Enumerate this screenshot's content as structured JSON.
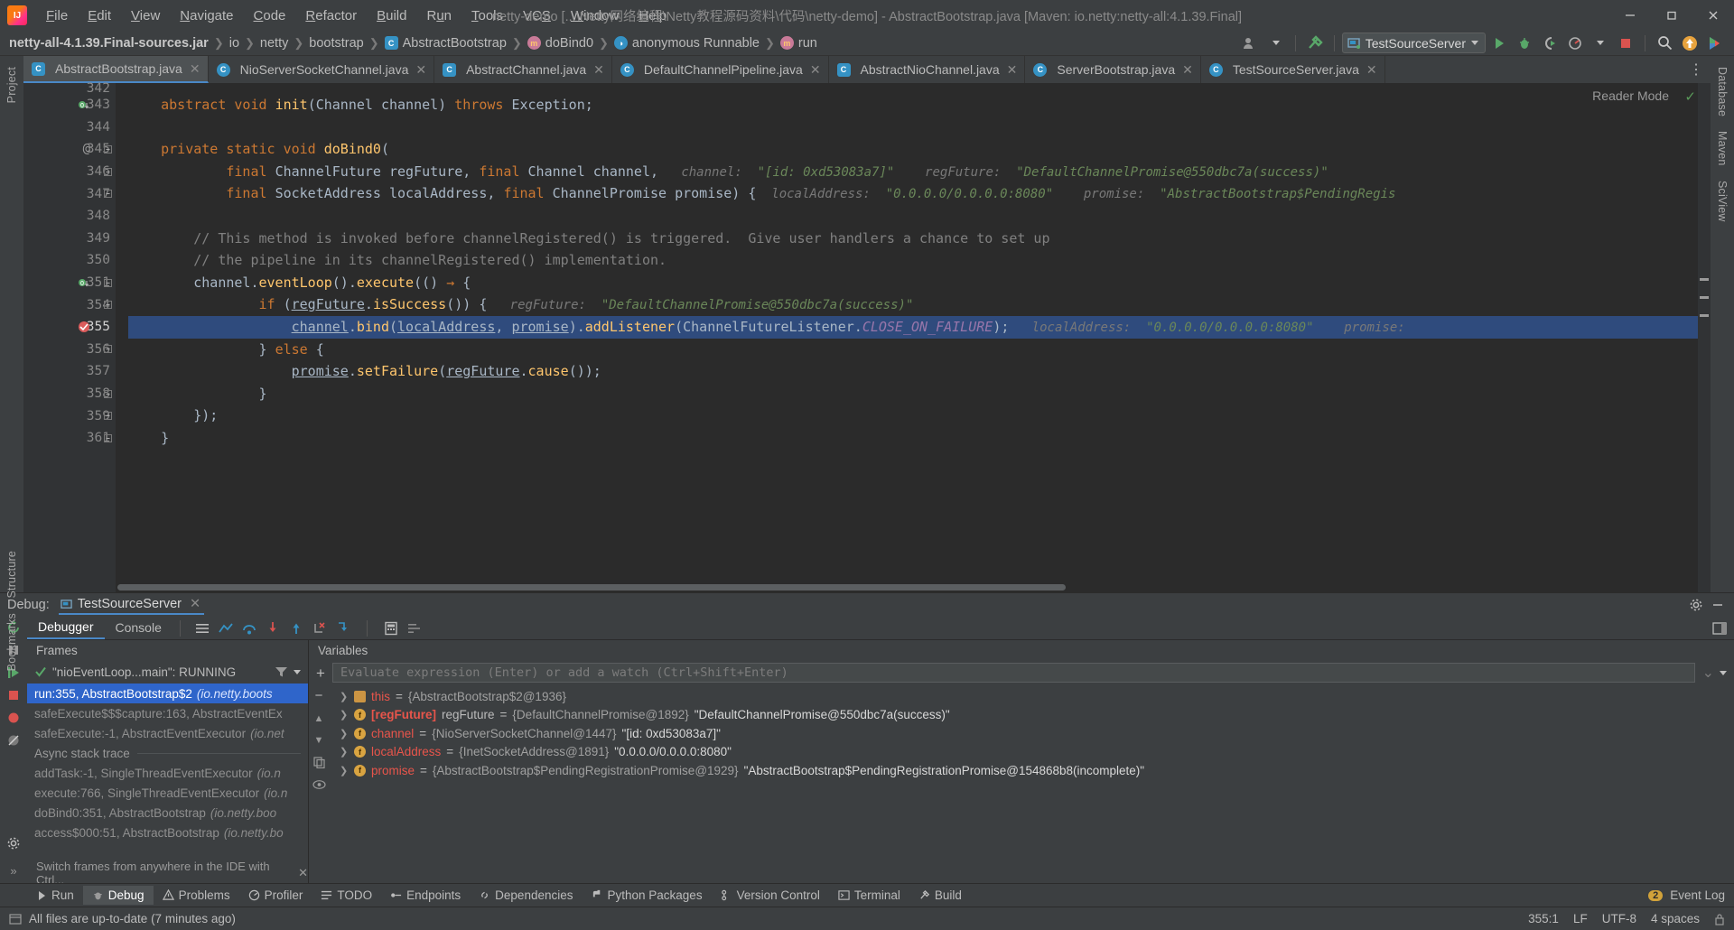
{
  "window": {
    "title": "netty-demo [...\\Netty网络编程\\Netty教程源码资料\\代码\\netty-demo] - AbstractBootstrap.java [Maven: io.netty:netty-all:4.1.39.Final]",
    "minimize": "—",
    "maximize": "▢",
    "close": "✕"
  },
  "menubar": [
    {
      "label": "File"
    },
    {
      "label": "Edit"
    },
    {
      "label": "View"
    },
    {
      "label": "Navigate"
    },
    {
      "label": "Code"
    },
    {
      "label": "Refactor"
    },
    {
      "label": "Build"
    },
    {
      "label": "Run"
    },
    {
      "label": "Tools"
    },
    {
      "label": "VCS"
    },
    {
      "label": "Window"
    },
    {
      "label": "Help"
    }
  ],
  "breadcrumbs": [
    {
      "label": "netty-all-4.1.39.Final-sources.jar",
      "icon": "jar-icon"
    },
    {
      "label": "io",
      "icon": "package-icon"
    },
    {
      "label": "netty",
      "icon": "package-icon"
    },
    {
      "label": "bootstrap",
      "icon": "package-icon"
    },
    {
      "label": "AbstractBootstrap",
      "icon": "class-icon"
    },
    {
      "label": "doBind0",
      "icon": "method-icon"
    },
    {
      "label": "anonymous Runnable",
      "icon": "anonymous-class-icon"
    },
    {
      "label": "run",
      "icon": "method-icon"
    }
  ],
  "toolbar": {
    "run_config": "TestSourceServer",
    "run_label": "Run",
    "debug_label": "Debug",
    "run_coverage_label": "Run with Coverage",
    "profile_label": "Profile",
    "stop_label": "Stop",
    "search_label": "Search Everywhere",
    "update_label": "Update Project",
    "share_label": "Share"
  },
  "editor_tabs": [
    {
      "label": "AbstractBootstrap.java",
      "active": true
    },
    {
      "label": "NioServerSocketChannel.java",
      "active": false
    },
    {
      "label": "AbstractChannel.java",
      "active": false
    },
    {
      "label": "DefaultChannelPipeline.java",
      "active": false
    },
    {
      "label": "AbstractNioChannel.java",
      "active": false
    },
    {
      "label": "ServerBootstrap.java",
      "active": false
    },
    {
      "label": "TestSourceServer.java",
      "active": false
    }
  ],
  "editor": {
    "reader_mode": "Reader Mode",
    "lines": [
      {
        "num": "342",
        "partial": true,
        "tokens": []
      },
      {
        "num": "343",
        "gutter_icon": "implemented-method-icon",
        "tokens": [
          {
            "t": "indent",
            "v": "    "
          },
          {
            "t": "kw",
            "v": "abstract void "
          },
          {
            "t": "mth",
            "v": "init"
          },
          {
            "t": "id",
            "v": "(Channel channel) "
          },
          {
            "t": "kw",
            "v": "throws "
          },
          {
            "t": "id",
            "v": "Exception;"
          }
        ]
      },
      {
        "num": "344",
        "tokens": []
      },
      {
        "num": "345",
        "gutter_icon": "annotation-icon",
        "fold": true,
        "tokens": [
          {
            "t": "indent",
            "v": "    "
          },
          {
            "t": "kw",
            "v": "private static void "
          },
          {
            "t": "mth",
            "v": "doBind0"
          },
          {
            "t": "id",
            "v": "("
          }
        ]
      },
      {
        "num": "346",
        "fold": true,
        "tokens": [
          {
            "t": "indent",
            "v": "            "
          },
          {
            "t": "kw",
            "v": "final "
          },
          {
            "t": "id",
            "v": "ChannelFuture regFuture, "
          },
          {
            "t": "kw",
            "v": "final "
          },
          {
            "t": "id",
            "v": "Channel channel,"
          },
          {
            "t": "hint",
            "v": "   channel:  "
          },
          {
            "t": "hintv",
            "v": "\"[id: 0xd53083a7]\""
          },
          {
            "t": "hint",
            "v": "    regFuture:  "
          },
          {
            "t": "hintv",
            "v": "\"DefaultChannelPromise@550dbc7a(success)\""
          }
        ]
      },
      {
        "num": "347",
        "fold": true,
        "tokens": [
          {
            "t": "indent",
            "v": "            "
          },
          {
            "t": "kw",
            "v": "final "
          },
          {
            "t": "id",
            "v": "SocketAddress localAddress, "
          },
          {
            "t": "kw",
            "v": "final "
          },
          {
            "t": "id",
            "v": "ChannelPromise promise) {"
          },
          {
            "t": "hint",
            "v": "  localAddress:  "
          },
          {
            "t": "hintv",
            "v": "\"0.0.0.0/0.0.0.0:8080\""
          },
          {
            "t": "hint",
            "v": "    promise:  "
          },
          {
            "t": "hintv",
            "v": "\"AbstractBootstrap$PendingRegis"
          }
        ]
      },
      {
        "num": "348",
        "tokens": []
      },
      {
        "num": "349",
        "tokens": [
          {
            "t": "indent",
            "v": "        "
          },
          {
            "t": "cmt",
            "v": "// This method is invoked before channelRegistered() is triggered.  Give user handlers a chance to set up"
          }
        ]
      },
      {
        "num": "350",
        "tokens": [
          {
            "t": "indent",
            "v": "        "
          },
          {
            "t": "cmt",
            "v": "// the pipeline in its channelRegistered() implementation."
          }
        ]
      },
      {
        "num": "351",
        "gutter_icon": "lambda-icon",
        "fold": true,
        "tokens": [
          {
            "t": "indent",
            "v": "        "
          },
          {
            "t": "id",
            "v": "channel."
          },
          {
            "t": "mth",
            "v": "eventLoop"
          },
          {
            "t": "id",
            "v": "()."
          },
          {
            "t": "mth",
            "v": "execute"
          },
          {
            "t": "id",
            "v": "(() "
          },
          {
            "t": "kw",
            "v": "→ "
          },
          {
            "t": "id",
            "v": "{"
          }
        ]
      },
      {
        "num": "354",
        "fold": true,
        "tokens": [
          {
            "t": "indent",
            "v": "                "
          },
          {
            "t": "kw",
            "v": "if "
          },
          {
            "t": "id",
            "v": "("
          },
          {
            "t": "ul",
            "v": "regFuture"
          },
          {
            "t": "id",
            "v": "."
          },
          {
            "t": "mth",
            "v": "isSuccess"
          },
          {
            "t": "id",
            "v": "()) {"
          },
          {
            "t": "hint",
            "v": "   regFuture:  "
          },
          {
            "t": "hintv",
            "v": "\"DefaultChannelPromise@550dbc7a(success)\""
          }
        ]
      },
      {
        "num": "355",
        "highlight": true,
        "gutter_icon": "breakpoint-hit-icon",
        "tokens": [
          {
            "t": "indent",
            "v": "                    "
          },
          {
            "t": "ul",
            "v": "channel"
          },
          {
            "t": "id",
            "v": "."
          },
          {
            "t": "mth",
            "v": "bind"
          },
          {
            "t": "id",
            "v": "("
          },
          {
            "t": "ul",
            "v": "localAddress"
          },
          {
            "t": "id",
            "v": ", "
          },
          {
            "t": "ul",
            "v": "promise"
          },
          {
            "t": "id",
            "v": ")."
          },
          {
            "t": "mth",
            "v": "addListener"
          },
          {
            "t": "id",
            "v": "(ChannelFutureListener."
          },
          {
            "t": "stat",
            "v": "CLOSE_ON_FAILURE"
          },
          {
            "t": "id",
            "v": ");"
          },
          {
            "t": "hint",
            "v": "   localAddress:  "
          },
          {
            "t": "hintv",
            "v": "\"0.0.0.0/0.0.0.0:8080\""
          },
          {
            "t": "hint",
            "v": "    promise:"
          }
        ]
      },
      {
        "num": "356",
        "fold": true,
        "tokens": [
          {
            "t": "indent",
            "v": "                "
          },
          {
            "t": "id",
            "v": "} "
          },
          {
            "t": "kw",
            "v": "else "
          },
          {
            "t": "id",
            "v": "{"
          }
        ]
      },
      {
        "num": "357",
        "tokens": [
          {
            "t": "indent",
            "v": "                    "
          },
          {
            "t": "ul",
            "v": "promise"
          },
          {
            "t": "id",
            "v": "."
          },
          {
            "t": "mth",
            "v": "setFailure"
          },
          {
            "t": "id",
            "v": "("
          },
          {
            "t": "ul",
            "v": "regFuture"
          },
          {
            "t": "id",
            "v": "."
          },
          {
            "t": "mth",
            "v": "cause"
          },
          {
            "t": "id",
            "v": "());"
          }
        ]
      },
      {
        "num": "358",
        "fold": true,
        "tokens": [
          {
            "t": "indent",
            "v": "                "
          },
          {
            "t": "id",
            "v": "}"
          }
        ]
      },
      {
        "num": "359",
        "fold": true,
        "tokens": [
          {
            "t": "indent",
            "v": "        "
          },
          {
            "t": "id",
            "v": "});"
          }
        ]
      },
      {
        "num": "361",
        "fold": true,
        "tokens": [
          {
            "t": "indent",
            "v": "    "
          },
          {
            "t": "id",
            "v": "}"
          }
        ]
      }
    ]
  },
  "debug": {
    "panel_label": "Debug:",
    "session_tab": "TestSourceServer",
    "tabs": [
      {
        "label": "Debugger",
        "active": true
      },
      {
        "label": "Console",
        "active": false
      }
    ],
    "frames_title": "Frames",
    "variables_title": "Variables",
    "thread": "\"nioEventLoop...main\": RUNNING",
    "frames": [
      {
        "text": "run:355, AbstractBootstrap$2",
        "loc": "(io.netty.boots",
        "selected": true
      },
      {
        "text": "safeExecute$$$capture:163, AbstractEventEx",
        "loc": "",
        "selected": false
      },
      {
        "text": "safeExecute:-1, AbstractEventExecutor",
        "loc": "(io.net",
        "selected": false
      }
    ],
    "async_label": "Async stack trace",
    "async_frames": [
      {
        "text": "addTask:-1, SingleThreadEventExecutor",
        "loc": "(io.n"
      },
      {
        "text": "execute:766, SingleThreadEventExecutor",
        "loc": "(io.n"
      },
      {
        "text": "doBind0:351, AbstractBootstrap",
        "loc": "(io.netty.boo"
      },
      {
        "text": "access$000:51, AbstractBootstrap",
        "loc": "(io.netty.bo"
      }
    ],
    "frames_hint": "Switch frames from anywhere in the IDE with Ctrl...",
    "eval_placeholder": "Evaluate expression (Enter) or add a watch (Ctrl+Shift+Enter)",
    "variables": [
      {
        "icon": "object-icon",
        "name": "this",
        "watch": "",
        "eq": " = ",
        "type": "{AbstractBootstrap$2@1936}",
        "value": ""
      },
      {
        "icon": "field-icon",
        "name": "regFuture",
        "watch": "[regFuture]",
        "eq": " = ",
        "type": "{DefaultChannelPromise@1892}",
        "value": "\"DefaultChannelPromise@550dbc7a(success)\""
      },
      {
        "icon": "field-icon",
        "name": "channel",
        "watch": "",
        "eq": " = ",
        "type": "{NioServerSocketChannel@1447}",
        "value": "\"[id: 0xd53083a7]\""
      },
      {
        "icon": "field-icon",
        "name": "localAddress",
        "watch": "",
        "eq": " = ",
        "type": "{InetSocketAddress@1891}",
        "value": "\"0.0.0.0/0.0.0.0:8080\""
      },
      {
        "icon": "field-icon",
        "name": "promise",
        "watch": "",
        "eq": " = ",
        "type": "{AbstractBootstrap$PendingRegistrationPromise@1929}",
        "value": "\"AbstractBootstrap$PendingRegistrationPromise@154868b8(incomplete)\""
      }
    ]
  },
  "bottom_tabs": [
    {
      "label": "Run",
      "icon": "run-icon",
      "active": false
    },
    {
      "label": "Debug",
      "icon": "debug-icon",
      "active": true
    },
    {
      "label": "Problems",
      "icon": "problems-icon",
      "active": false
    },
    {
      "label": "Profiler",
      "icon": "profiler-icon",
      "active": false
    },
    {
      "label": "TODO",
      "icon": "todo-icon",
      "active": false
    },
    {
      "label": "Endpoints",
      "icon": "endpoints-icon",
      "active": false
    },
    {
      "label": "Dependencies",
      "icon": "dependencies-icon",
      "active": false
    },
    {
      "label": "Python Packages",
      "icon": "python-icon",
      "active": false
    },
    {
      "label": "Version Control",
      "icon": "vcs-icon",
      "active": false
    },
    {
      "label": "Terminal",
      "icon": "terminal-icon",
      "active": false
    },
    {
      "label": "Build",
      "icon": "build-icon",
      "active": false
    }
  ],
  "event_log": {
    "label": "Event Log",
    "count": "2"
  },
  "status": {
    "message": "All files are up-to-date (7 minutes ago)",
    "caret": "355:1",
    "line_sep": "LF",
    "encoding": "UTF-8",
    "indent": "4 spaces"
  },
  "left_strip": [
    {
      "label": "Project",
      "icon": "project-icon"
    },
    {
      "label": "Structure",
      "icon": "structure-icon"
    },
    {
      "label": "Bookmarks",
      "icon": "bookmarks-icon"
    }
  ],
  "right_strip": [
    {
      "label": "Database",
      "icon": "database-icon"
    },
    {
      "label": "Maven",
      "icon": "maven-icon"
    },
    {
      "label": "SciView",
      "icon": "sciview-icon"
    }
  ],
  "colors": {
    "accent": "#4a88c7",
    "selection": "#2f65ca",
    "code_bg": "#2b2b2b",
    "chrome_bg": "#3c3f41",
    "highlight_line": "#2f4b7d",
    "keyword": "#cc7832",
    "method": "#ffc66d",
    "string": "#6a8759",
    "comment": "#808080",
    "var_name": "#e8554b"
  }
}
